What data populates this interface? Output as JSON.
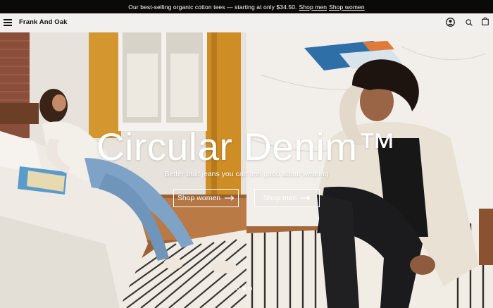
{
  "promo": {
    "text": "Our best-selling organic cotton tees — starting at only $34.50.",
    "link_men": "Shop men",
    "link_women": "Shop women"
  },
  "header": {
    "brand": "Frank And Oak",
    "icons": [
      "menu-icon",
      "account-icon",
      "search-icon",
      "bag-icon"
    ]
  },
  "hero": {
    "title": "Circular Denim™",
    "subtitle": "Better built jeans you can feel good about wearing",
    "button_women": "Shop women",
    "button_men": "Shop men",
    "slides": 3,
    "active_slide": 2
  },
  "colors": {
    "promo_bg": "#0a0a0a",
    "header_bg": "#f1f0ee",
    "text_light": "#ffffff"
  }
}
